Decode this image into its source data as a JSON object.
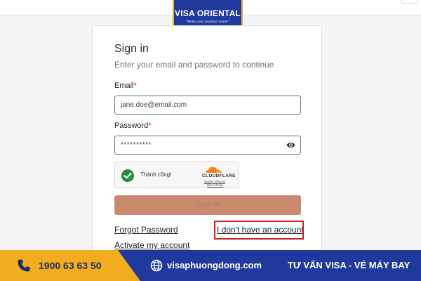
{
  "brand": {
    "name": "VISA ORIENTAL",
    "slogan": "\"Make your journeys easier\""
  },
  "signin": {
    "title": "Sign in",
    "subtitle": "Enter your email and password to continue",
    "email": {
      "label": "Email",
      "required_mark": "*",
      "value": "jane.doe@email.com"
    },
    "password": {
      "label": "Password",
      "required_mark": "*",
      "value": "**********"
    },
    "captcha": {
      "status": "Thành công!",
      "provider": "CLOUDFLARE",
      "privacy_link": "Quyền riêng tư",
      "terms_link": "Điều khoản"
    },
    "submit_label": "Sign In",
    "forgot_password": "Forgot Password",
    "no_account": "I don't have an account",
    "activate_account": "Activate my account"
  },
  "footer": {
    "phone": "1900 63 63 50",
    "website": "visaphuongdong.com",
    "services": "TƯ VẤN VISA - VÉ MÁY BAY"
  },
  "colors": {
    "brand_blue": "#1f3a9c",
    "brand_yellow": "#f2ad1e",
    "field_border": "#4d7c5f",
    "button_disabled": "#c98a6e",
    "highlight_red": "#d02020",
    "success_green": "#2b8a3e"
  }
}
